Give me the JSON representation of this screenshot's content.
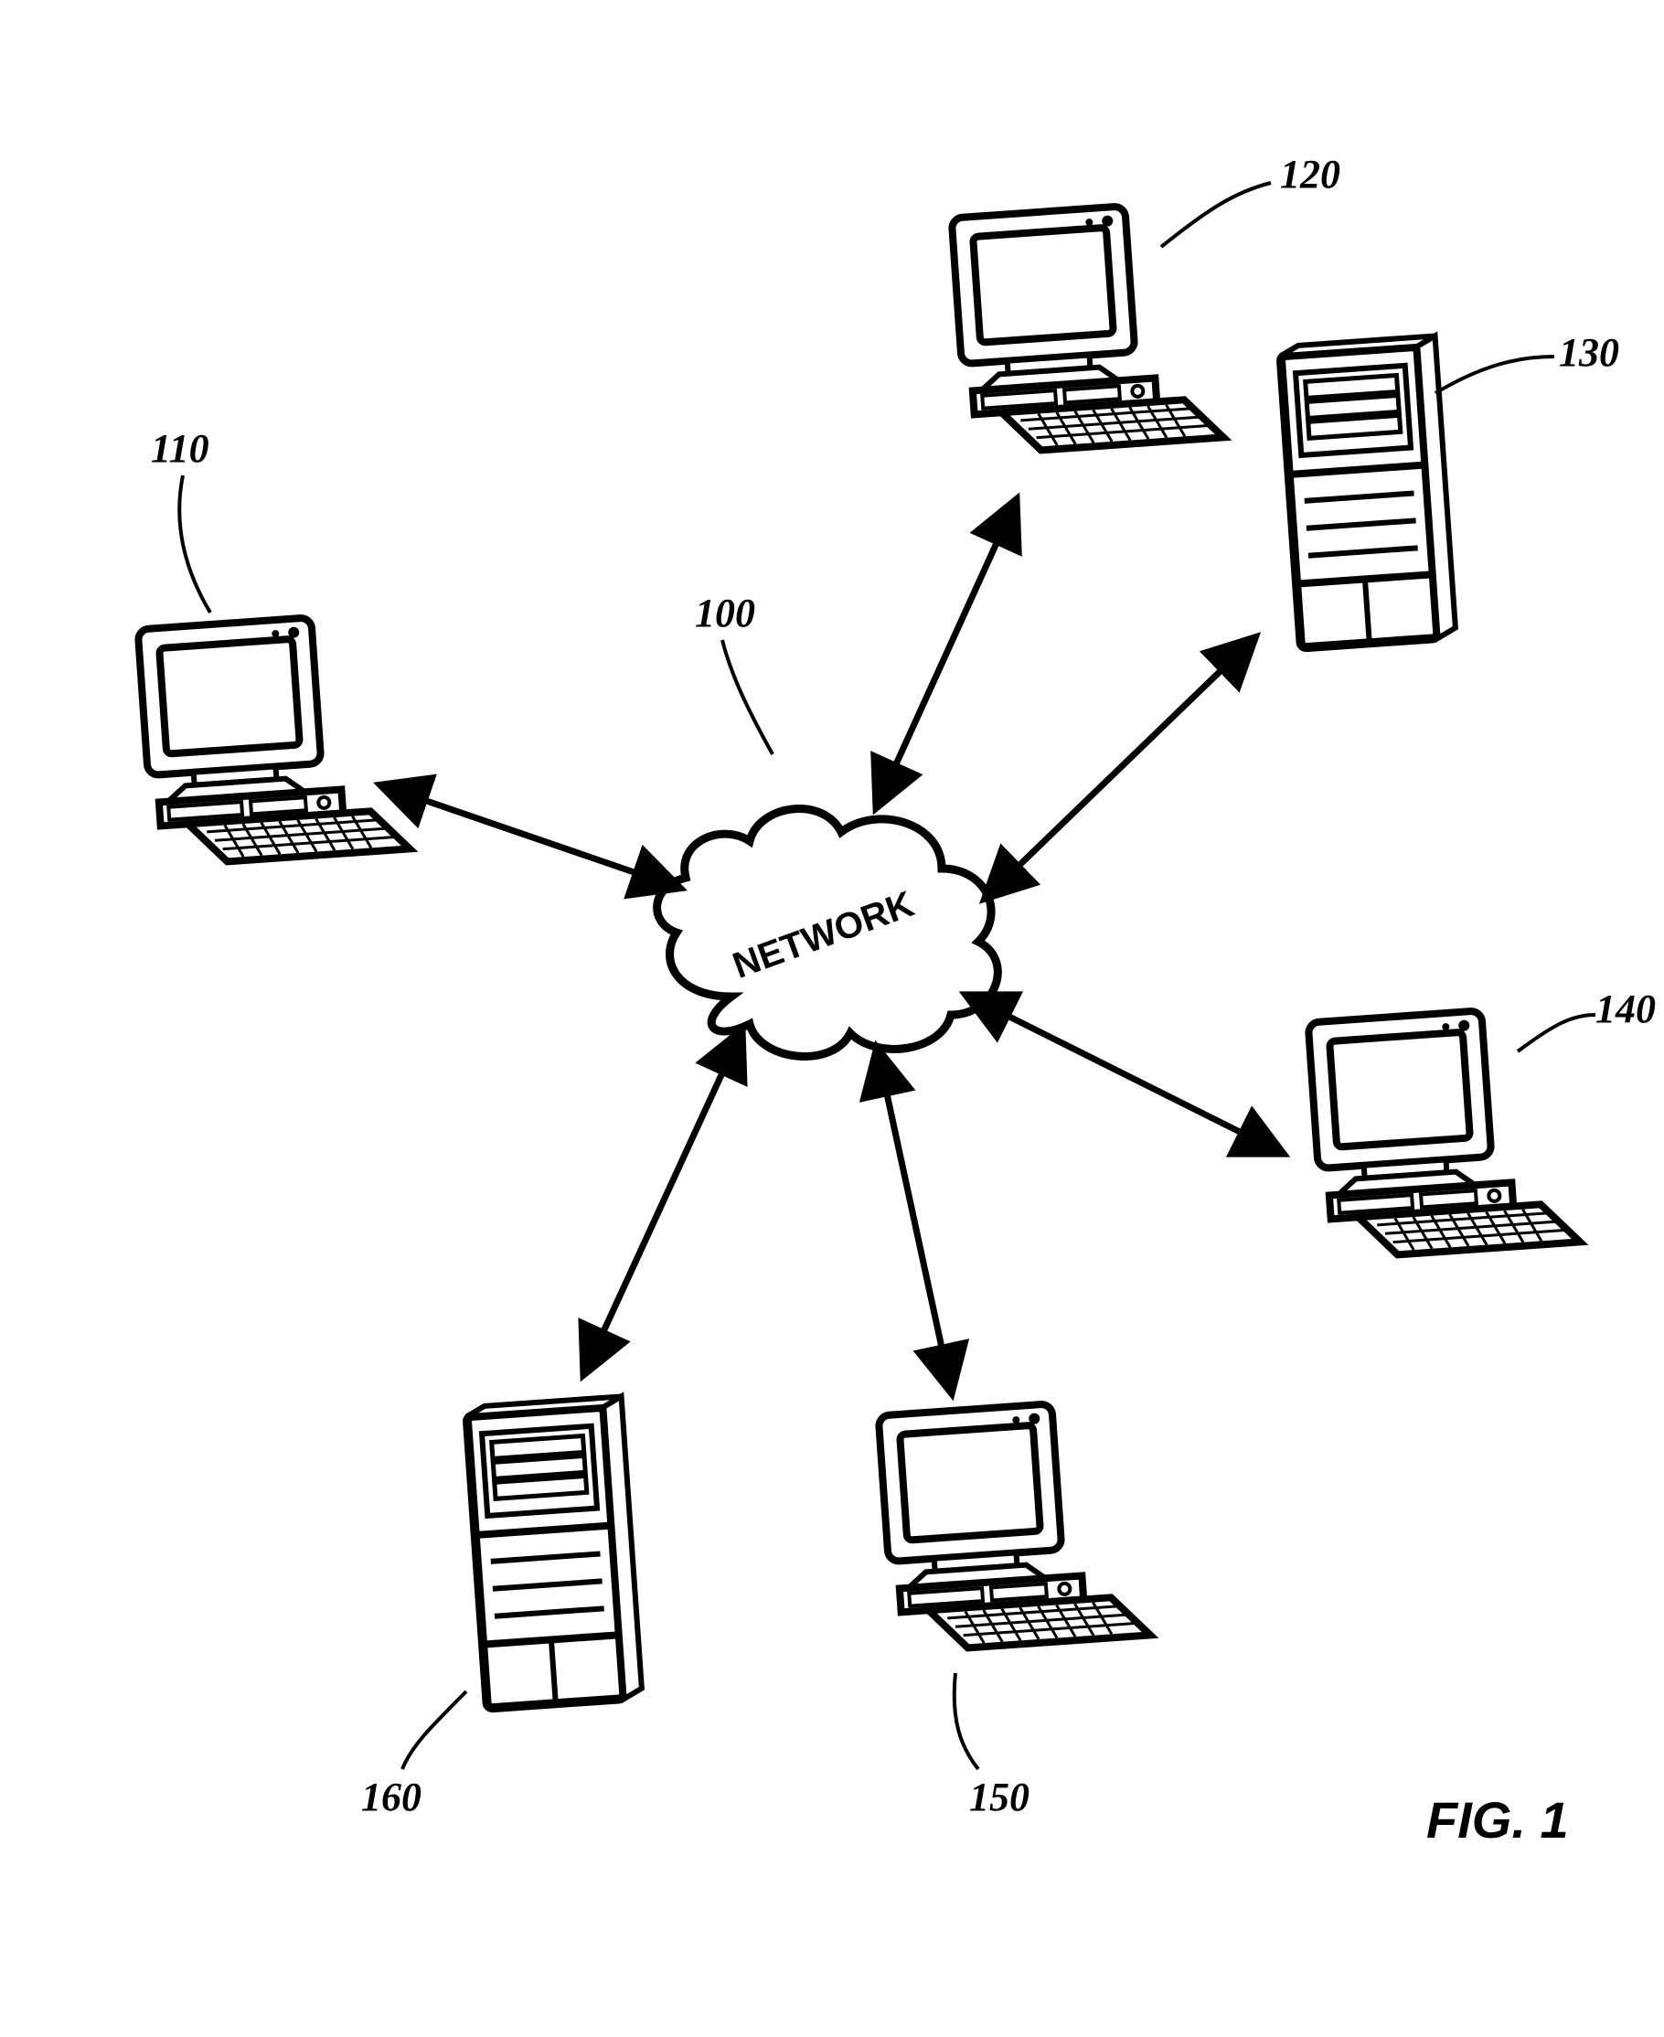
{
  "figure_caption": "FIG. 1",
  "network": {
    "label": "NETWORK",
    "ref": "100"
  },
  "nodes": [
    {
      "ref": "110",
      "type": "workstation"
    },
    {
      "ref": "120",
      "type": "workstation"
    },
    {
      "ref": "130",
      "type": "server"
    },
    {
      "ref": "140",
      "type": "workstation"
    },
    {
      "ref": "150",
      "type": "workstation"
    },
    {
      "ref": "160",
      "type": "server"
    }
  ]
}
